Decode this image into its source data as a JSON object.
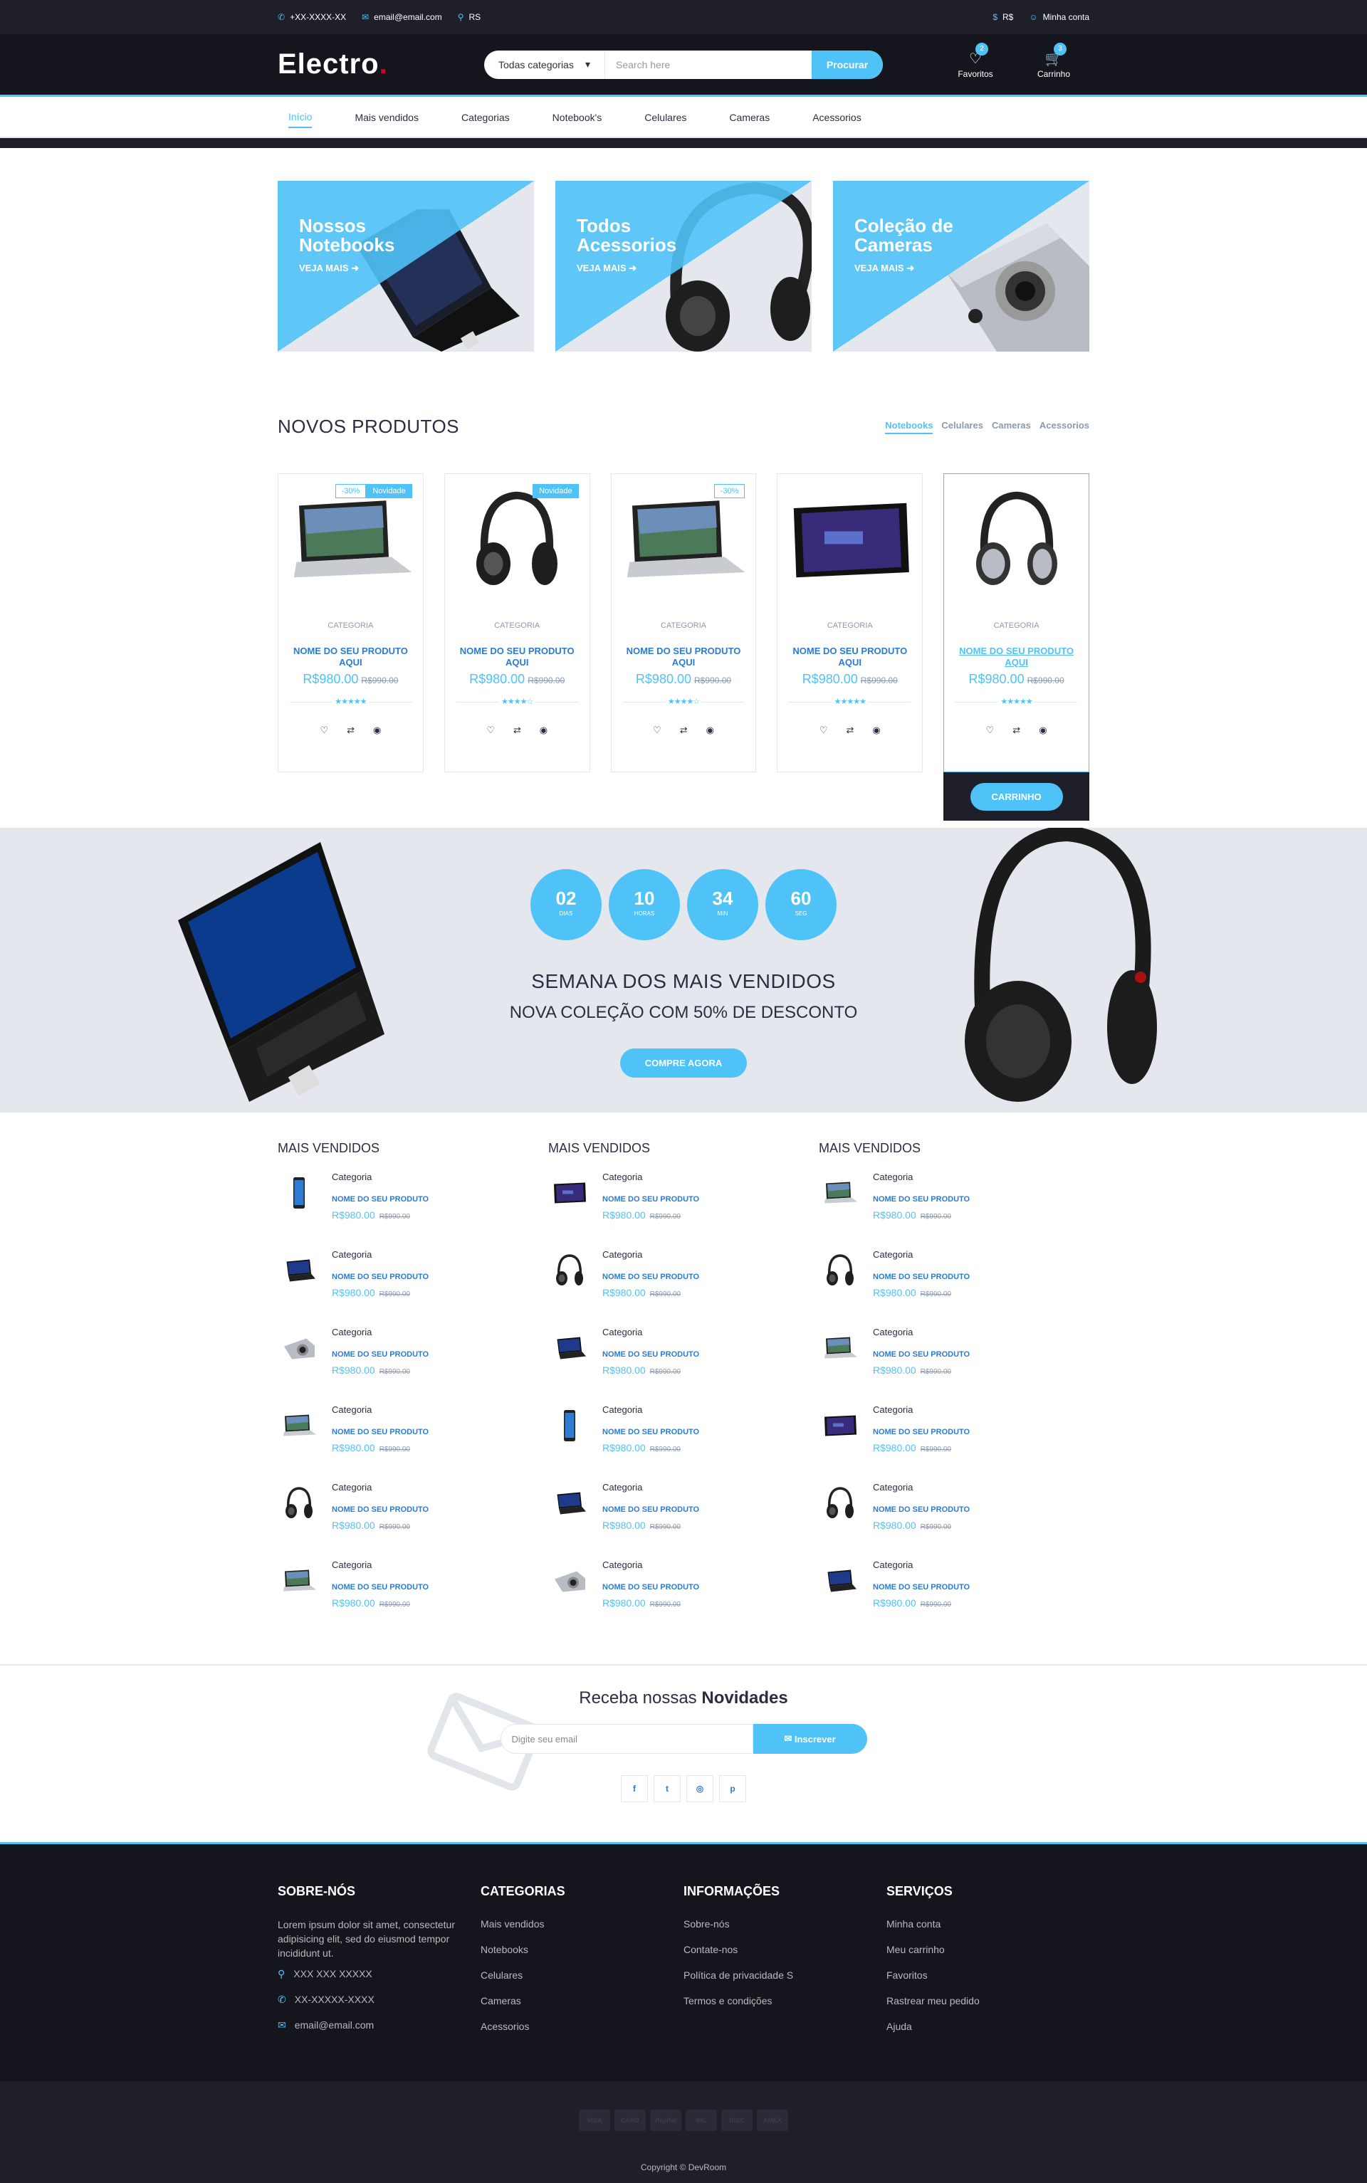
{
  "topbar": {
    "phone": "+XX-XXXX-XX",
    "email": "email@email.com",
    "location": "RS",
    "currency": "R$",
    "account": "Minha conta"
  },
  "header": {
    "logo": "Electro",
    "logo_dot": ".",
    "category_select": "Todas categorias",
    "search_placeholder": "Search here",
    "search_button": "Procurar",
    "wishlist_label": "Favoritos",
    "wishlist_qty": "2",
    "cart_label": "Carrinho",
    "cart_qty": "3"
  },
  "nav": [
    "Início",
    "Mais vendidos",
    "Categorias",
    "Notebook's",
    "Celulares",
    "Cameras",
    "Acessorios"
  ],
  "shops": [
    {
      "title1": "Nossos",
      "title2": "Notebooks",
      "cta": "VEJA MAIS"
    },
    {
      "title1": "Todos",
      "title2": "Acessorios",
      "cta": "VEJA MAIS"
    },
    {
      "title1": "Coleção de",
      "title2": "Cameras",
      "cta": "VEJA MAIS"
    }
  ],
  "new_products": {
    "title": "NOVOS PRODUTOS",
    "tabs": [
      "Notebooks",
      "Celulares",
      "Cameras",
      "Acessorios"
    ],
    "items": [
      {
        "sale": "-30%",
        "new": "Novidade",
        "category": "CATEGORIA",
        "name": "NOME DO SEU PRODUTO AQUI",
        "price": "R$980.00",
        "old_price": "R$990.00",
        "rating": 5,
        "image": "laptop"
      },
      {
        "sale": "",
        "new": "Novidade",
        "category": "CATEGORIA",
        "name": "NOME DO SEU PRODUTO AQUI",
        "price": "R$980.00",
        "old_price": "R$990.00",
        "rating": 4,
        "image": "headphones"
      },
      {
        "sale": "-30%",
        "new": "",
        "category": "CATEGORIA",
        "name": "NOME DO SEU PRODUTO AQUI",
        "price": "R$980.00",
        "old_price": "R$990.00",
        "rating": 4,
        "image": "laptop"
      },
      {
        "sale": "",
        "new": "",
        "category": "CATEGORIA",
        "name": "NOME DO SEU PRODUTO AQUI",
        "price": "R$980.00",
        "old_price": "R$990.00",
        "rating": 5,
        "image": "tablet"
      },
      {
        "sale": "",
        "new": "",
        "category": "CATEGORIA",
        "name": "NOME DO SEU PRODUTO AQUI",
        "price": "R$980.00",
        "old_price": "R$990.00",
        "rating": 5,
        "image": "headphones-silver"
      }
    ],
    "add_to_cart": "CARRINHO"
  },
  "hot_deal": {
    "countdown": [
      {
        "n": "02",
        "l": "DIAS"
      },
      {
        "n": "10",
        "l": "HORAS"
      },
      {
        "n": "34",
        "l": "MIN"
      },
      {
        "n": "60",
        "l": "SEG"
      }
    ],
    "title": "SEMANA DOS MAIS VENDIDOS",
    "subtitle": "NOVA COLEÇÃO COM 50% DE DESCONTO",
    "cta": "COMPRE AGORA"
  },
  "best_sellers": [
    {
      "title": "MAIS VENDIDOS",
      "items": [
        {
          "cat": "Categoria",
          "name": "NOME DO SEU PRODUTO",
          "price": "R$980.00",
          "old": "R$990.00",
          "img": "phone"
        },
        {
          "cat": "Categoria",
          "name": "NOME DO SEU PRODUTO",
          "price": "R$980.00",
          "old": "R$990.00",
          "img": "laptop-dark"
        },
        {
          "cat": "Categoria",
          "name": "NOME DO SEU PRODUTO",
          "price": "R$980.00",
          "old": "R$990.00",
          "img": "camera"
        },
        {
          "cat": "Categoria",
          "name": "NOME DO SEU PRODUTO",
          "price": "R$980.00",
          "old": "R$990.00",
          "img": "laptop"
        },
        {
          "cat": "Categoria",
          "name": "NOME DO SEU PRODUTO",
          "price": "R$980.00",
          "old": "R$990.00",
          "img": "headphones"
        },
        {
          "cat": "Categoria",
          "name": "NOME DO SEU PRODUTO",
          "price": "R$980.00",
          "old": "R$990.00",
          "img": "laptop"
        }
      ]
    },
    {
      "title": "MAIS VENDIDOS",
      "items": [
        {
          "cat": "Categoria",
          "name": "NOME DO SEU PRODUTO",
          "price": "R$980.00",
          "old": "R$990.00",
          "img": "tablet"
        },
        {
          "cat": "Categoria",
          "name": "NOME DO SEU PRODUTO",
          "price": "R$980.00",
          "old": "R$990.00",
          "img": "headphones"
        },
        {
          "cat": "Categoria",
          "name": "NOME DO SEU PRODUTO",
          "price": "R$980.00",
          "old": "R$990.00",
          "img": "laptop-dark"
        },
        {
          "cat": "Categoria",
          "name": "NOME DO SEU PRODUTO",
          "price": "R$980.00",
          "old": "R$990.00",
          "img": "phone"
        },
        {
          "cat": "Categoria",
          "name": "NOME DO SEU PRODUTO",
          "price": "R$980.00",
          "old": "R$990.00",
          "img": "laptop-dark"
        },
        {
          "cat": "Categoria",
          "name": "NOME DO SEU PRODUTO",
          "price": "R$980.00",
          "old": "R$990.00",
          "img": "camera"
        }
      ]
    },
    {
      "title": "MAIS VENDIDOS",
      "items": [
        {
          "cat": "Categoria",
          "name": "NOME DO SEU PRODUTO",
          "price": "R$980.00",
          "old": "R$990.00",
          "img": "laptop"
        },
        {
          "cat": "Categoria",
          "name": "NOME DO SEU PRODUTO",
          "price": "R$980.00",
          "old": "R$990.00",
          "img": "headphones"
        },
        {
          "cat": "Categoria",
          "name": "NOME DO SEU PRODUTO",
          "price": "R$980.00",
          "old": "R$990.00",
          "img": "laptop"
        },
        {
          "cat": "Categoria",
          "name": "NOME DO SEU PRODUTO",
          "price": "R$980.00",
          "old": "R$990.00",
          "img": "tablet"
        },
        {
          "cat": "Categoria",
          "name": "NOME DO SEU PRODUTO",
          "price": "R$980.00",
          "old": "R$990.00",
          "img": "headphones"
        },
        {
          "cat": "Categoria",
          "name": "NOME DO SEU PRODUTO",
          "price": "R$980.00",
          "old": "R$990.00",
          "img": "laptop-dark"
        }
      ]
    }
  ],
  "newsletter": {
    "title_a": "Receba nossas ",
    "title_b": "Novidades",
    "placeholder": "Digite seu email",
    "button": "Inscrever",
    "social": [
      "f",
      "t",
      "◎",
      "p"
    ]
  },
  "footer": {
    "about": {
      "title": "SOBRE-NÓS",
      "text": "Lorem ipsum dolor sit amet, consectetur adipisicing elit, sed do eiusmod tempor incididunt ut.",
      "address": "XXX XXX XXXXX",
      "phone": "XX-XXXXX-XXXX",
      "email": "email@email.com"
    },
    "categories": {
      "title": "CATEGORIAS",
      "links": [
        "Mais vendidos",
        "Notebooks",
        "Celulares",
        "Cameras",
        "Acessorios"
      ]
    },
    "info": {
      "title": "INFORMAÇÕES",
      "links": [
        "Sobre-nós",
        "Contate-nos",
        "Política de privacidade S",
        "Termos e condições"
      ]
    },
    "services": {
      "title": "SERVIÇOS",
      "links": [
        "Minha conta",
        "Meu carrinho",
        "Favoritos",
        "Rastrear meu pedido",
        "Ajuda"
      ]
    }
  },
  "bottom": {
    "payments": [
      "VISA",
      "CARD",
      "PayPal",
      "MC",
      "DISC",
      "AMEX"
    ],
    "copyright": "Copyright © DevRoom"
  },
  "colors": {
    "accent": "#4fc3f7",
    "dark": "#15161d",
    "brand_red": "#d10024"
  }
}
